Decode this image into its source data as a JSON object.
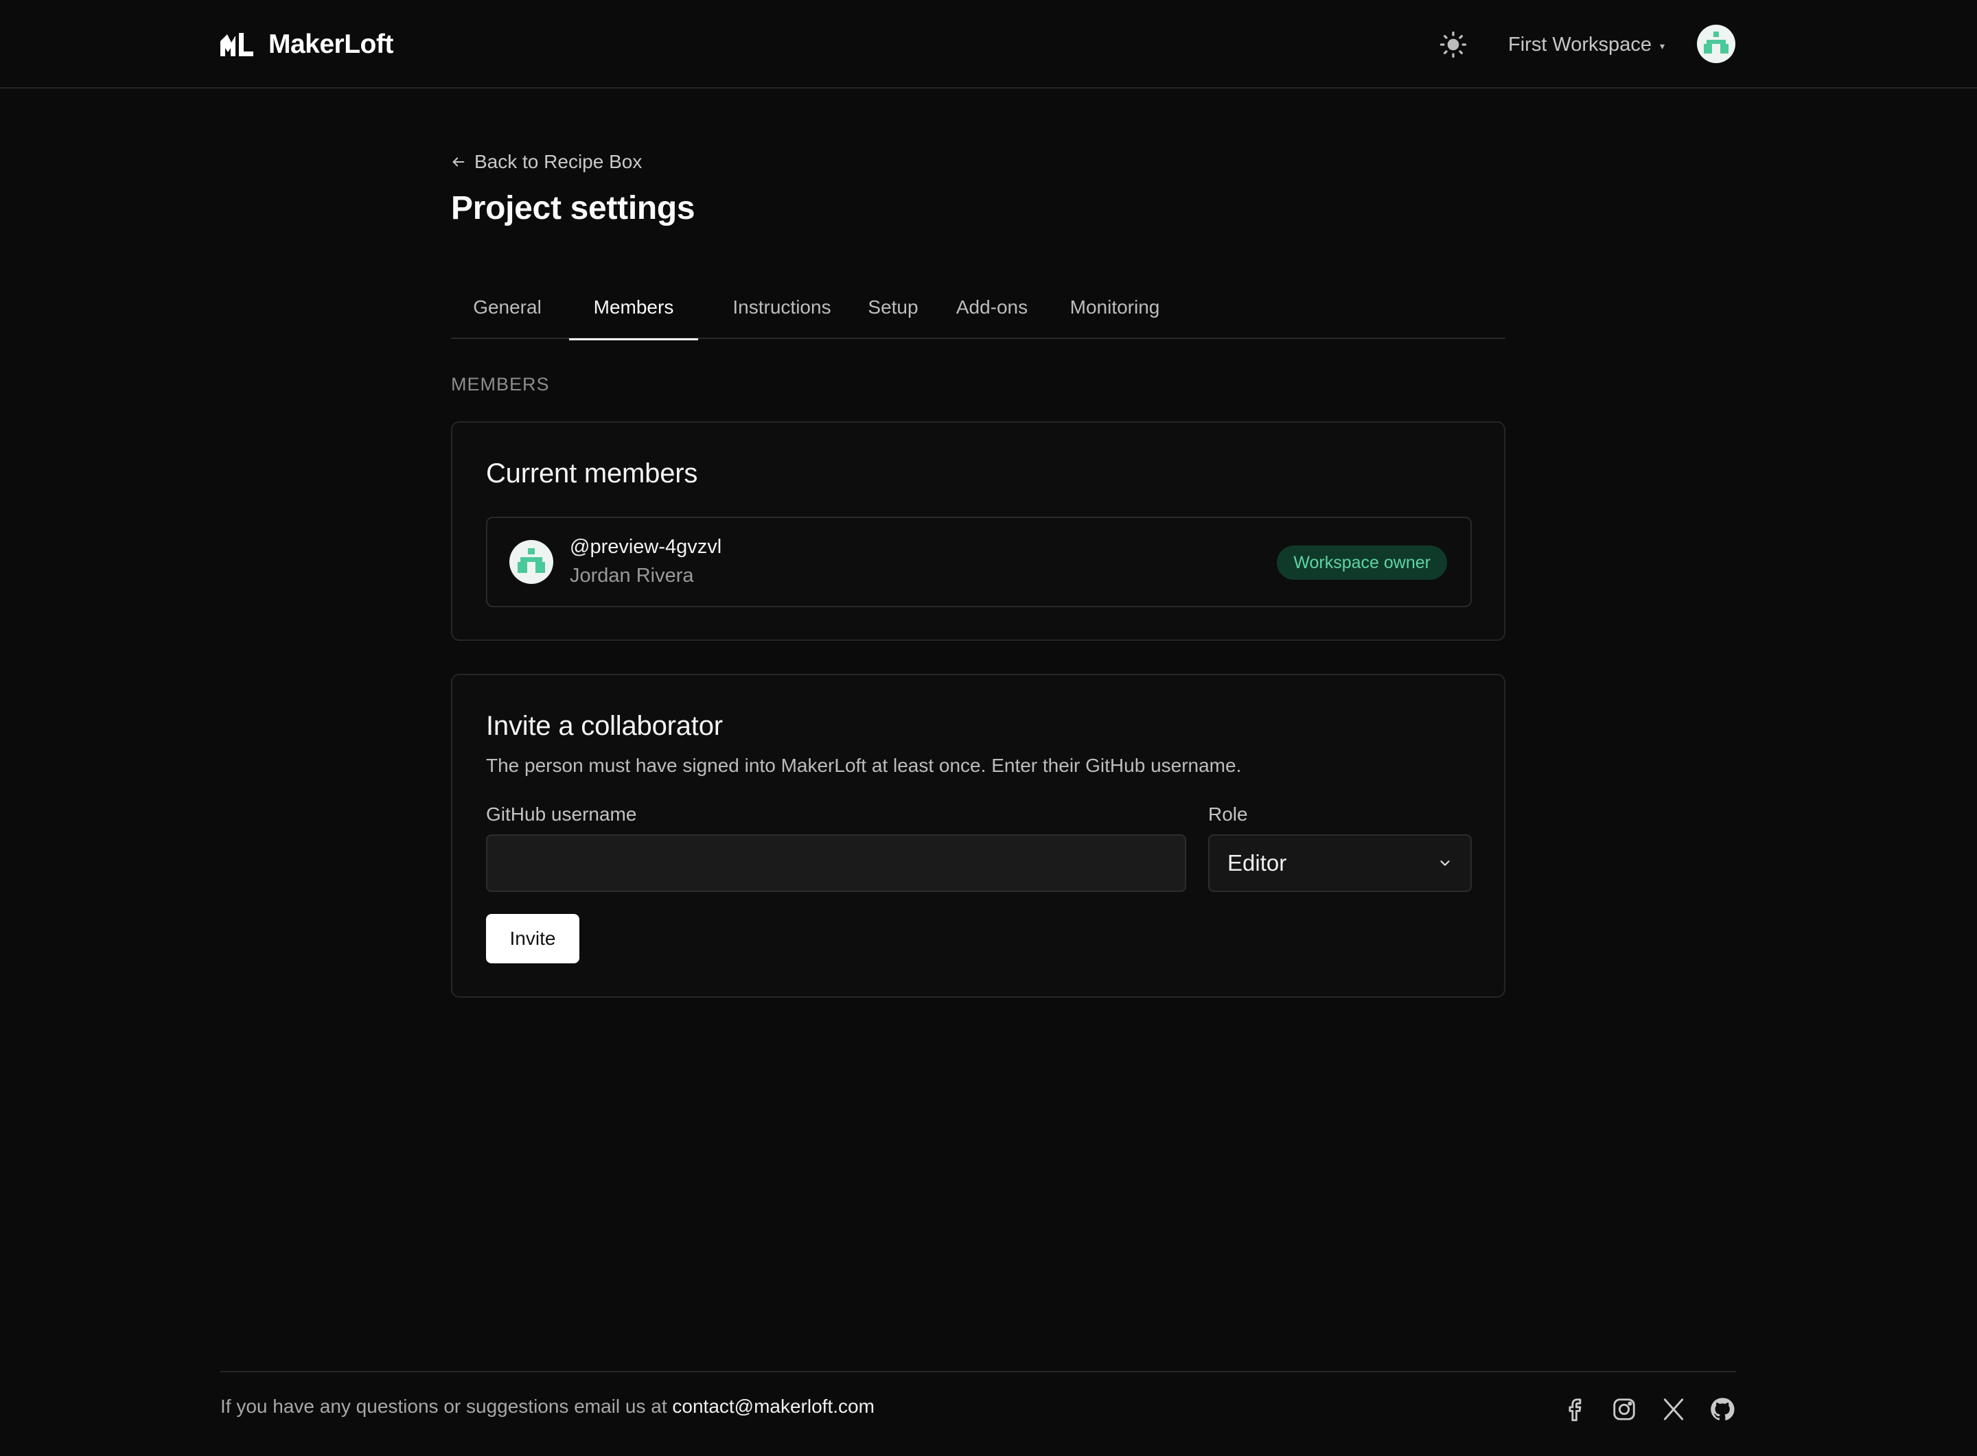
{
  "brand": {
    "name": "MakerLoft",
    "logo_icon": "makerloft-logo-icon"
  },
  "header": {
    "theme_icon": "sun-icon",
    "workspace_label": "First Workspace",
    "workspace_caret": "▾"
  },
  "nav": {
    "back_label": "Back to Recipe Box",
    "page_title": "Project settings"
  },
  "tabs": [
    {
      "label": "General",
      "active": false
    },
    {
      "label": "Members",
      "active": true
    },
    {
      "label": "Instructions",
      "active": false
    },
    {
      "label": "Setup",
      "active": false
    },
    {
      "label": "Add-ons",
      "active": false
    },
    {
      "label": "Monitoring",
      "active": false
    }
  ],
  "members_section": {
    "label": "MEMBERS",
    "title": "Current members",
    "members": [
      {
        "handle": "@preview-4gvzvl",
        "name": "Jordan Rivera",
        "badge": "Workspace owner"
      }
    ]
  },
  "invite": {
    "title": "Invite a collaborator",
    "description": "The person must have signed into MakerLoft at least once. Enter their GitHub username.",
    "username_label": "GitHub username",
    "username_value": "",
    "username_placeholder": "",
    "role_label": "Role",
    "role_value": "Editor",
    "button_label": "Invite"
  },
  "footer": {
    "text": "If you have any questions or suggestions email us at ",
    "email": "contact@makerloft.com",
    "social": [
      "facebook-icon",
      "instagram-icon",
      "x-twitter-icon",
      "github-icon"
    ]
  },
  "colors": {
    "background": "#0b0b0b",
    "badge_bg": "#0f3a2a",
    "badge_text": "#5fd4a2",
    "avatar_accent": "#4cc99a"
  }
}
